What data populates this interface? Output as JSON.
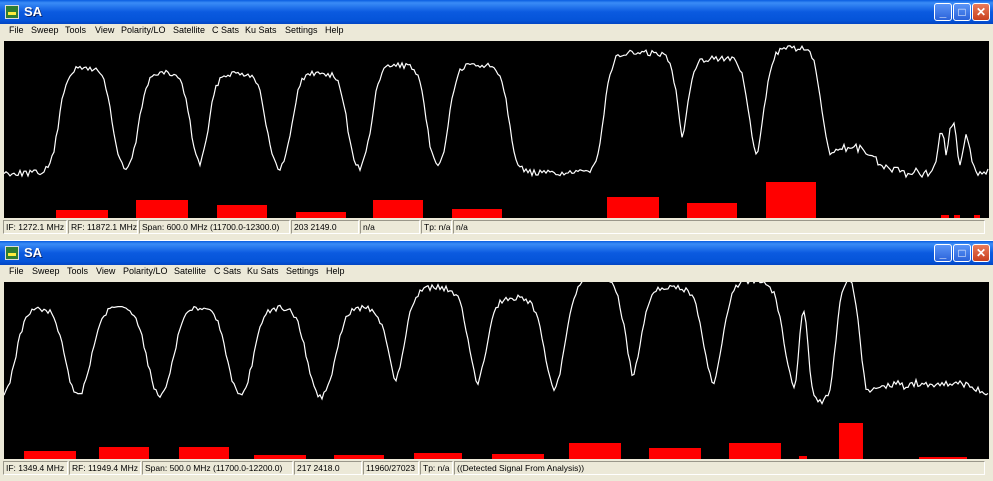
{
  "windows": [
    {
      "title": "SA",
      "menu": [
        "File",
        "Sweep",
        "Tools",
        "View",
        "Polarity/LO",
        "Satellite",
        "C Sats",
        "Ku Sats",
        "Settings",
        "Help"
      ],
      "status": [
        "IF: 1272.1 MHz",
        "RF: 11872.1 MHz",
        "Span: 600.0 MHz (11700.0-12300.0)",
        "203 2149.0",
        "n/a",
        "Tp: n/a",
        "n/a"
      ],
      "colors": {
        "trace": "#ffffff",
        "bars": "#ff0000",
        "background": "#000000"
      }
    },
    {
      "title": "SA",
      "menu": [
        "File",
        "Sweep",
        "Tools",
        "View",
        "Polarity/LO",
        "Satellite",
        "C Sats",
        "Ku Sats",
        "Settings",
        "Help"
      ],
      "status": [
        "IF: 1349.4 MHz",
        "RF: 11949.4 MHz",
        "Span: 500.0 MHz (11700.0-12200.0)",
        "217 2418.0",
        "11960/27023",
        "Tp: n/a",
        "((Detected Signal From Analysis))"
      ],
      "colors": {
        "trace": "#ffffff",
        "bars": "#ff0000",
        "background": "#000000"
      }
    }
  ],
  "title_buttons": {
    "minimize": "minimize-icon",
    "maximize": "maximize-icon",
    "close": "close-icon"
  }
}
